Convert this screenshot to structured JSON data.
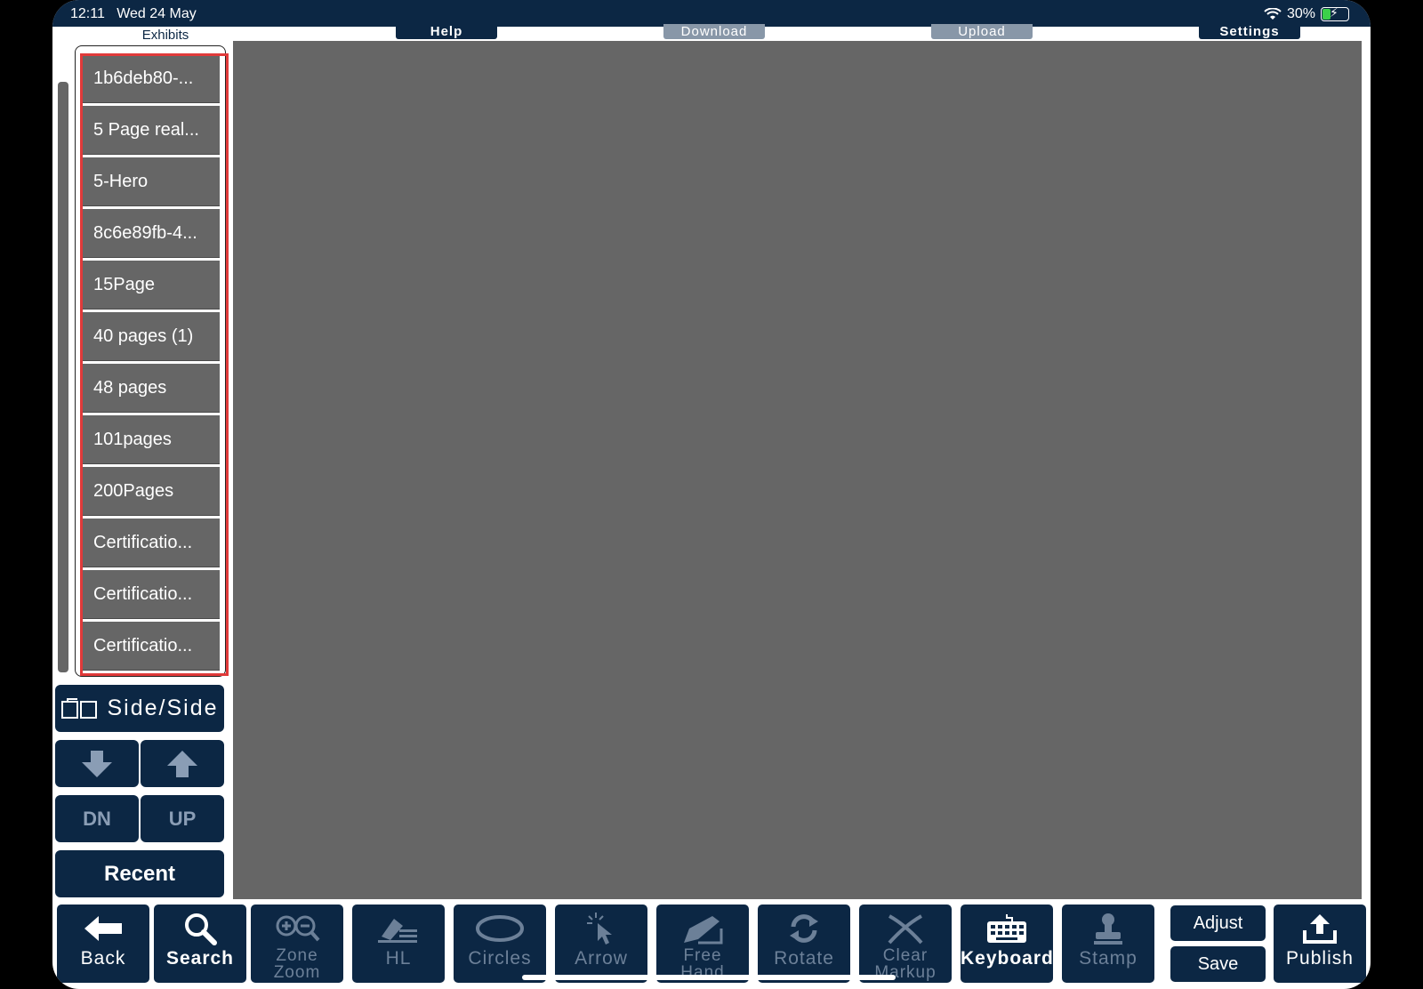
{
  "status_bar": {
    "time": "12:11",
    "date": "Wed 24 May",
    "battery": "30%"
  },
  "top_buttons": {
    "help": "Help",
    "download": "Download",
    "upload": "Upload",
    "settings": "Settings"
  },
  "exhibits": {
    "title": "Exhibits",
    "items": [
      "1b6deb80-...",
      "5 Page real...",
      "5-Hero",
      "8c6e89fb-4...",
      "15Page",
      "40 pages (1)",
      "48 pages",
      "101pages",
      "200Pages",
      "Certificatio...",
      "Certificatio...",
      "Certificatio..."
    ]
  },
  "left_panel": {
    "side_side": "Side/Side",
    "dn": "DN",
    "up": "UP",
    "recent": "Recent"
  },
  "toolbar": {
    "back": "Back",
    "search": "Search",
    "zone_zoom_1": "Zone",
    "zone_zoom_2": "Zoom",
    "hl": "HL",
    "circles": "Circles",
    "arrow": "Arrow",
    "free_hand_1": "Free",
    "free_hand_2": "Hand",
    "rotate": "Rotate",
    "clear_markup_1": "Clear",
    "clear_markup_2": "Markup",
    "keyboard": "Keyboard",
    "stamp": "Stamp",
    "adjust": "Adjust",
    "save": "Save",
    "publish": "Publish"
  },
  "colors": {
    "navy": "#0c2744",
    "viewer_gray": "#666666",
    "highlight_red": "#e03a3a"
  }
}
